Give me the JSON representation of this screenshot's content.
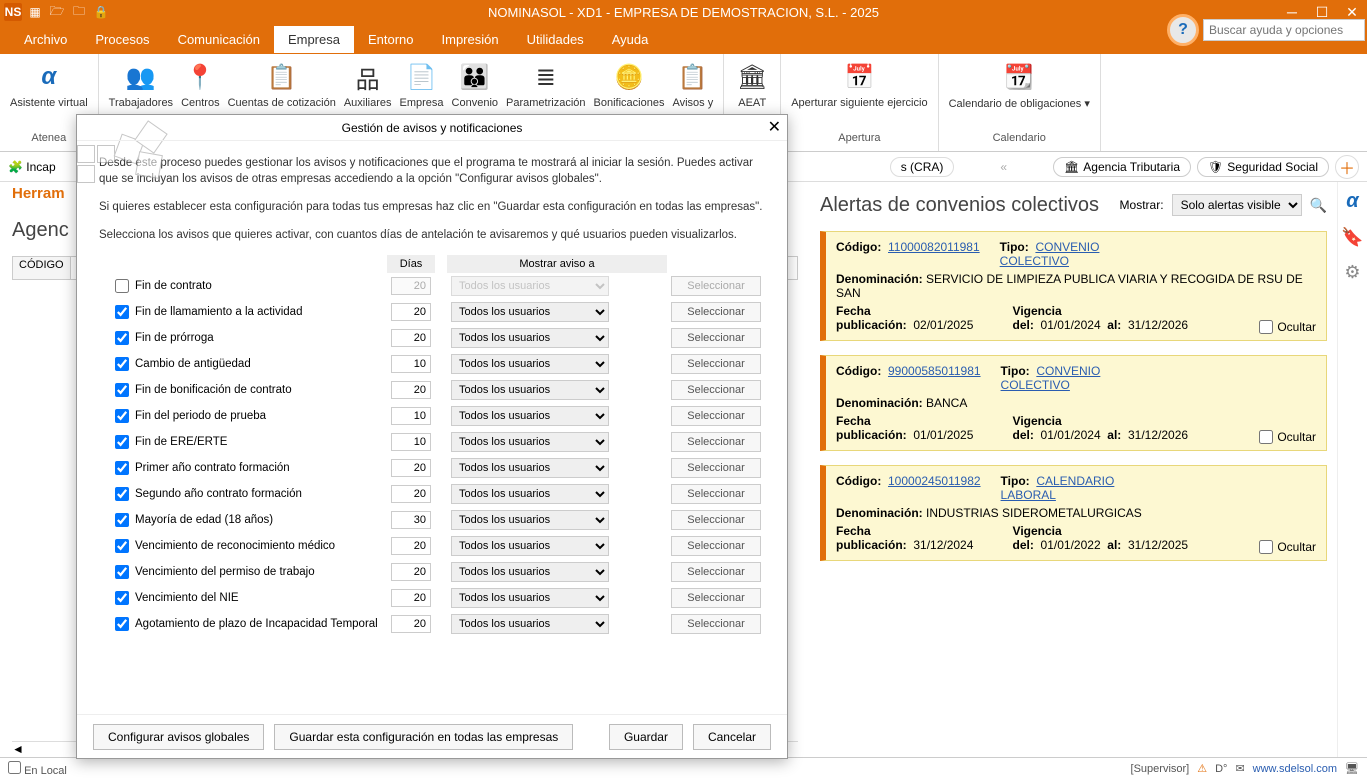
{
  "app": {
    "title": "NOMINASOL - XD1 - EMPRESA DE DEMOSTRACION, S.L. - 2025",
    "ns": "NS",
    "search_placeholder": "Buscar ayuda y opciones"
  },
  "menu": {
    "tabs": [
      "Archivo",
      "Procesos",
      "Comunicación",
      "Empresa",
      "Entorno",
      "Impresión",
      "Utilidades",
      "Ayuda"
    ],
    "active": 3
  },
  "ribbon": {
    "btns": [
      {
        "label": "Asistente virtual",
        "footer": "Atenea"
      },
      {
        "label": "Trabajadores"
      },
      {
        "label": "Centros"
      },
      {
        "label": "Cuentas de cotización"
      },
      {
        "label": "Auxiliares"
      },
      {
        "label": "Empresa"
      },
      {
        "label": "Convenio"
      },
      {
        "label": "Parametrización"
      },
      {
        "label": "Bonificaciones"
      },
      {
        "label": "Avisos y"
      },
      {
        "label": "AEAT"
      },
      {
        "label": "Aperturar siguiente ejercicio",
        "footer": "Apertura"
      },
      {
        "label": "Calendario de obligaciones ▾",
        "footer": "Calendario"
      }
    ]
  },
  "subbar": {
    "left": "Incap",
    "cra": "s (CRA)",
    "chev": "«",
    "links": [
      {
        "label": "Agencia Tributaria"
      },
      {
        "label": "Seguridad Social"
      }
    ]
  },
  "left": {
    "tool": "Herram",
    "heading": "Agenc",
    "col": "CÓDIGO"
  },
  "alerts": {
    "title": "Alertas de convenios colectivos",
    "mostrar": "Mostrar:",
    "filter": "Solo alertas visibles",
    "ocultar": "Ocultar",
    "items": [
      {
        "codigo": "11000082011981",
        "tipo": "CONVENIO COLECTIVO",
        "denom": "SERVICIO DE LIMPIEZA PUBLICA VIARIA Y RECOGIDA DE RSU DE SAN",
        "fpub": "02/01/2025",
        "vdel": "01/01/2024",
        "val": "31/12/2026"
      },
      {
        "codigo": "99000585011981",
        "tipo": "CONVENIO COLECTIVO",
        "denom": "BANCA",
        "fpub": "01/01/2025",
        "vdel": "01/01/2024",
        "val": "31/12/2026"
      },
      {
        "codigo": "10000245011982",
        "tipo": "CALENDARIO LABORAL",
        "denom": "INDUSTRIAS SIDEROMETALURGICAS",
        "fpub": "31/12/2024",
        "vdel": "01/01/2022",
        "val": "31/12/2025"
      }
    ],
    "labels": {
      "codigo": "Código:",
      "tipo": "Tipo:",
      "denom": "Denominación:",
      "fpub": "Fecha publicación:",
      "vdel": "Vigencia del:",
      "al": "al:"
    }
  },
  "dialog": {
    "title": "Gestión de avisos y notificaciones",
    "p1": "Desde este proceso puedes gestionar los avisos y notificaciones que el programa te mostrará al iniciar la sesión. Puedes activar que se incluyan los avisos de otras empresas accediendo a la opción \"Configurar avisos globales\".",
    "p2": "Si quieres establecer esta configuración para todas tus empresas haz clic en \"Guardar esta configuración en todas las empresas\".",
    "p3": "Selecciona los avisos que quieres activar, con cuantos días de antelación te avisaremos y qué usuarios pueden visualizarlos.",
    "th_dias": "Días",
    "th_mostrar": "Mostrar aviso a",
    "usuario": "Todos los usuarios",
    "seleccionar": "Seleccionar",
    "rows": [
      {
        "chk": false,
        "label": "Fin de contrato",
        "dias": "20",
        "disabled": true
      },
      {
        "chk": true,
        "label": "Fin de llamamiento a la actividad",
        "dias": "20"
      },
      {
        "chk": true,
        "label": "Fin de prórroga",
        "dias": "20"
      },
      {
        "chk": true,
        "label": "Cambio de antigüedad",
        "dias": "10"
      },
      {
        "chk": true,
        "label": "Fin de bonificación de contrato",
        "dias": "20"
      },
      {
        "chk": true,
        "label": "Fin del periodo de prueba",
        "dias": "10"
      },
      {
        "chk": true,
        "label": "Fin de ERE/ERTE",
        "dias": "10"
      },
      {
        "chk": true,
        "label": "Primer año contrato formación",
        "dias": "20"
      },
      {
        "chk": true,
        "label": "Segundo año contrato formación",
        "dias": "20"
      },
      {
        "chk": true,
        "label": "Mayoría de edad (18 años)",
        "dias": "30"
      },
      {
        "chk": true,
        "label": "Vencimiento de reconocimiento médico",
        "dias": "20"
      },
      {
        "chk": true,
        "label": "Vencimiento del permiso de trabajo",
        "dias": "20"
      },
      {
        "chk": true,
        "label": "Vencimiento del NIE",
        "dias": "20"
      },
      {
        "chk": true,
        "label": "Agotamiento de plazo de Incapacidad Temporal",
        "dias": "20"
      }
    ],
    "btns": {
      "global": "Configurar avisos globales",
      "saveall": "Guardar esta configuración en todas las empresas",
      "guardar": "Guardar",
      "cancelar": "Cancelar"
    }
  },
  "status": {
    "left": "En Local",
    "sup": "[Supervisor]",
    "url": "www.sdelsol.com"
  }
}
